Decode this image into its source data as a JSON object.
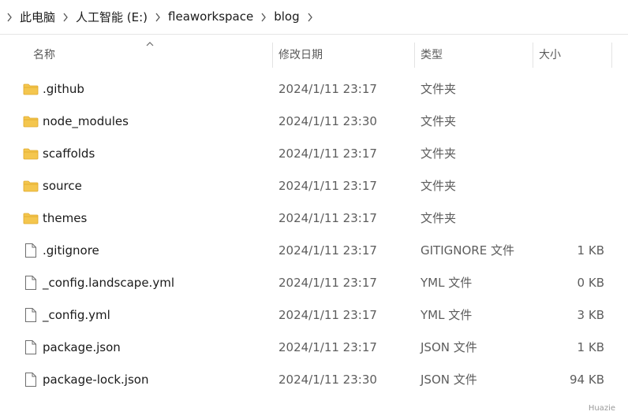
{
  "breadcrumb": {
    "items": [
      "此电脑",
      "人工智能 (E:)",
      "fleaworkspace",
      "blog"
    ]
  },
  "columns": {
    "name": "名称",
    "date": "修改日期",
    "type": "类型",
    "size": "大小"
  },
  "sort": {
    "column": "name",
    "direction": "ascending",
    "icon": "sort-up-chevron"
  },
  "rows": [
    {
      "kind": "folder",
      "icon": "folder-icon",
      "name": ".github",
      "date": "2024/1/11 23:17",
      "type": "文件夹",
      "size": ""
    },
    {
      "kind": "folder",
      "icon": "folder-icon",
      "name": "node_modules",
      "date": "2024/1/11 23:30",
      "type": "文件夹",
      "size": ""
    },
    {
      "kind": "folder",
      "icon": "folder-icon",
      "name": "scaffolds",
      "date": "2024/1/11 23:17",
      "type": "文件夹",
      "size": ""
    },
    {
      "kind": "folder",
      "icon": "folder-icon",
      "name": "source",
      "date": "2024/1/11 23:17",
      "type": "文件夹",
      "size": ""
    },
    {
      "kind": "folder",
      "icon": "folder-icon",
      "name": "themes",
      "date": "2024/1/11 23:17",
      "type": "文件夹",
      "size": ""
    },
    {
      "kind": "file",
      "icon": "file-icon",
      "name": ".gitignore",
      "date": "2024/1/11 23:17",
      "type": "GITIGNORE 文件",
      "size": "1 KB"
    },
    {
      "kind": "file",
      "icon": "file-icon",
      "name": "_config.landscape.yml",
      "date": "2024/1/11 23:17",
      "type": "YML 文件",
      "size": "0 KB"
    },
    {
      "kind": "file",
      "icon": "file-icon",
      "name": "_config.yml",
      "date": "2024/1/11 23:17",
      "type": "YML 文件",
      "size": "3 KB"
    },
    {
      "kind": "file",
      "icon": "file-icon",
      "name": "package.json",
      "date": "2024/1/11 23:17",
      "type": "JSON 文件",
      "size": "1 KB"
    },
    {
      "kind": "file",
      "icon": "file-icon",
      "name": "package-lock.json",
      "date": "2024/1/11 23:30",
      "type": "JSON 文件",
      "size": "94 KB"
    }
  ],
  "colors": {
    "folder": "#f4c64e",
    "folder_dark": "#e0a92b",
    "file_stroke": "#6e6e6e"
  },
  "watermark": "Huazie"
}
